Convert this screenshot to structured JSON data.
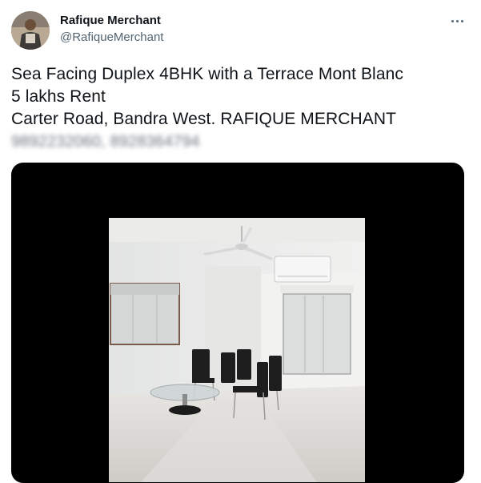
{
  "author": {
    "name": "Rafique Merchant",
    "handle": "@RafiqueMerchant"
  },
  "tweet": {
    "lines": [
      "Sea Facing Duplex 4BHK with a Terrace Mont Blanc",
      "5 lakhs Rent",
      "Carter Road, Bandra West. RAFIQUE MERCHANT"
    ],
    "blurred_contact": "9892232060, 8928364794"
  },
  "media": {
    "description_icon": "photo"
  },
  "icons": {
    "more": "more-icon"
  }
}
